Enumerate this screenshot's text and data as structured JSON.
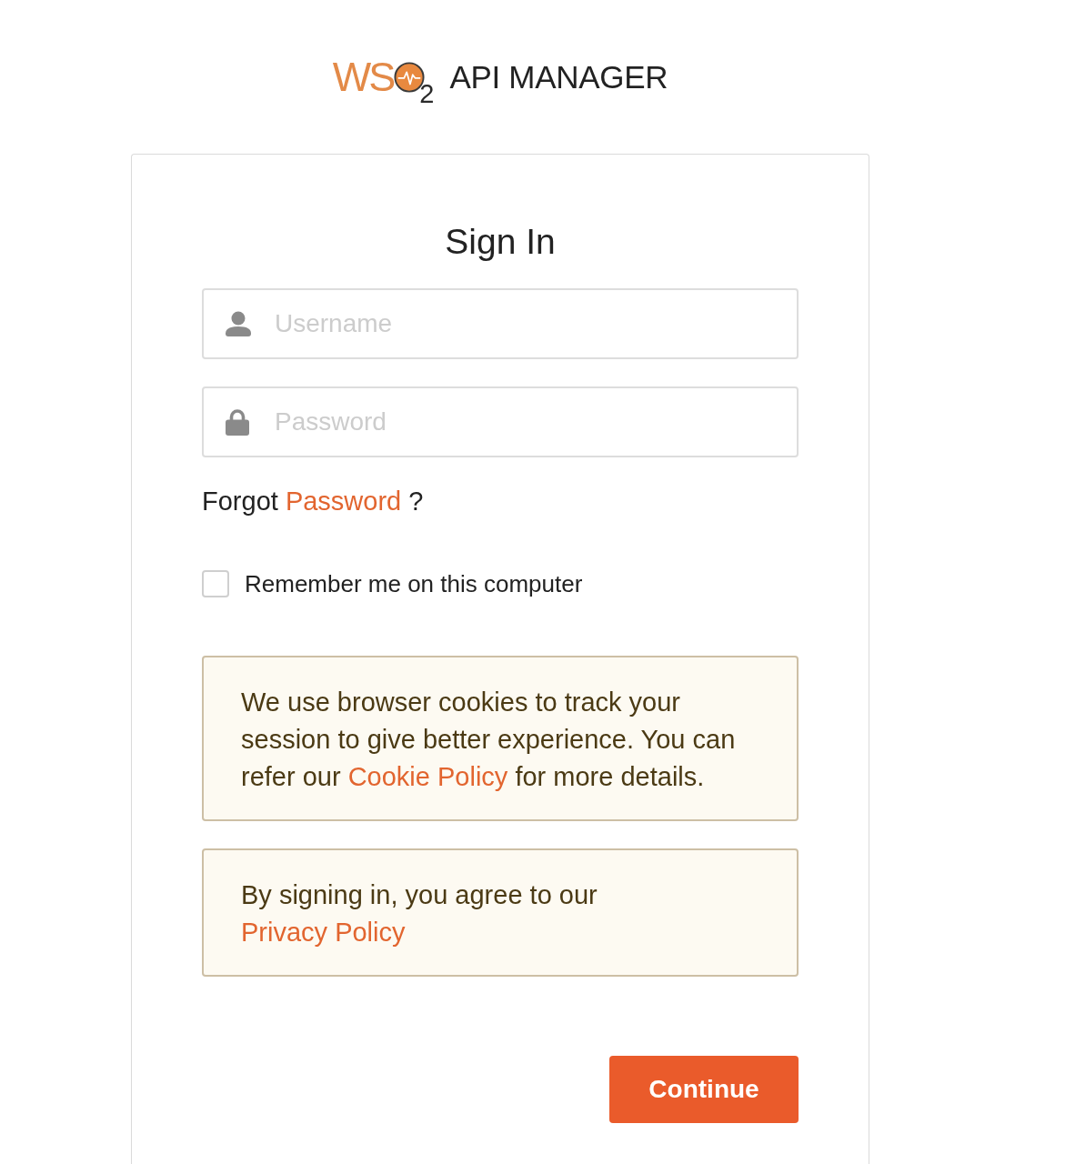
{
  "logo": {
    "wordmark": "WS",
    "subscript": "2",
    "product": "API MANAGER"
  },
  "card": {
    "title": "Sign In",
    "fields": [
      {
        "kind": "username",
        "placeholder": "Username"
      },
      {
        "kind": "password",
        "placeholder": "Password"
      }
    ],
    "forgot": {
      "text_before": "Forgot",
      "link": "Password",
      "text_after": "?"
    },
    "remember": {
      "label": "Remember me on this computer",
      "checked": false
    },
    "notices": [
      {
        "text_before": "We use browser cookies to track your session to give better experience. You can refer our",
        "link": "Cookie Policy",
        "text_after": "for more details."
      },
      {
        "text_before": "By signing in, you agree to our",
        "link": "Privacy Policy"
      }
    ],
    "button": {
      "label": "Continue"
    }
  }
}
